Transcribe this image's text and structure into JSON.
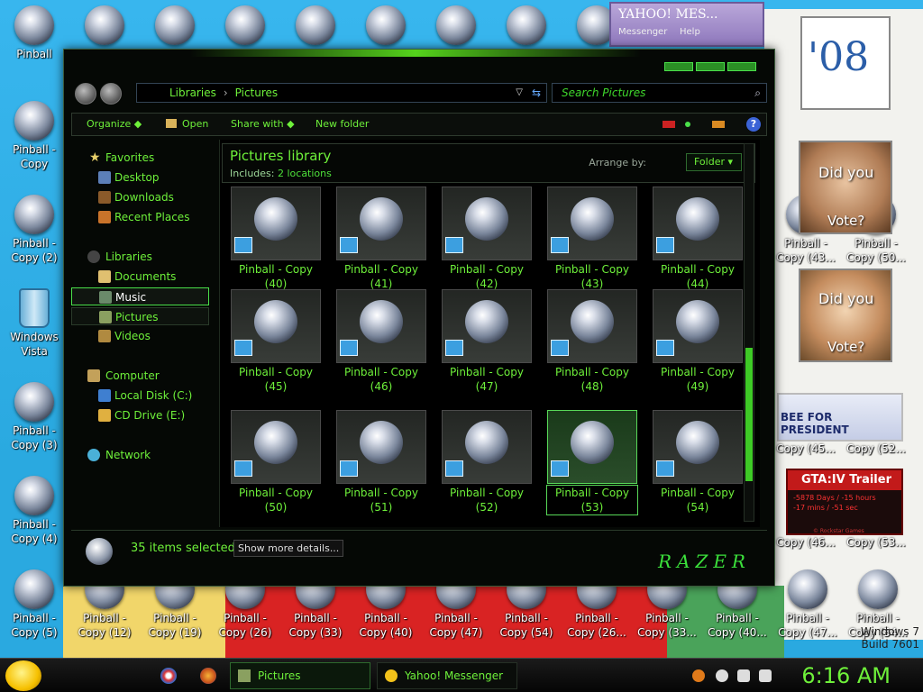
{
  "desktop": {
    "icons": [
      {
        "label": "Pinball"
      },
      {
        "label": "Pinball -\nCopy"
      },
      {
        "label": "Pinball -\nCopy (2)"
      },
      {
        "label": "Windows\nVista"
      },
      {
        "label": "Pinball -\nCopy (3)"
      },
      {
        "label": "Pinball -\nCopy (4)"
      },
      {
        "label": "Pinball -\nCopy (5)"
      }
    ],
    "bottom_row": [
      "Pinball -\nCopy (12)",
      "Pinball -\nCopy (19)",
      "Pinball -\nCopy (26)",
      "Pinball -\nCopy (33)",
      "Pinball -\nCopy (40)",
      "Pinball -\nCopy (47)",
      "Pinball -\nCopy (54)",
      "Pinball -\nCopy (26...",
      "Pinball -\nCopy (33...",
      "Pinball -\nCopy (40...",
      "Pinball -\nCopy (47...",
      "Pinball -\nCopy (54..."
    ],
    "right_labels": [
      "Pinball -\nCopy (43...",
      "Pinball -\nCopy (50...",
      "Copy (45...",
      "Copy (52...",
      "Copy (46...",
      "Copy (53..."
    ],
    "watermark": "Windows 7\nBuild 7601"
  },
  "gadgets": {
    "yahoo_title": "YAHOO! MES...",
    "yahoo_sub1": "Messenger",
    "yahoo_sub2": "Help",
    "year": "'08",
    "did_you_1": "Did you",
    "vote_1": "Vote?",
    "did_you_2": "Did you",
    "vote_2": "Vote?",
    "president": "BEE FOR PRESIDENT",
    "gta_title": "GTA:IV Trailer",
    "gta_line1": "-5878 Days / -15 hours",
    "gta_line2": "-17 mins / -51 sec",
    "gta_credit": "© Rockstar Games"
  },
  "explorer": {
    "address": {
      "part1": "Libraries",
      "part2": "Pictures"
    },
    "search_placeholder": "Search Pictures",
    "toolbar": {
      "organize": "Organize",
      "open": "Open",
      "share_with": "Share with",
      "new_folder": "New folder"
    },
    "nav": {
      "favorites": "Favorites",
      "desktop": "Desktop",
      "downloads": "Downloads",
      "recent": "Recent Places",
      "libraries": "Libraries",
      "documents": "Documents",
      "music": "Music",
      "pictures": "Pictures",
      "videos": "Videos",
      "computer": "Computer",
      "local_disk": "Local Disk (C:)",
      "cd_drive": "CD Drive (E:)",
      "network": "Network"
    },
    "library": {
      "title": "Pictures library",
      "includes_label": "Includes:",
      "locations": "2 locations",
      "arrange_by": "Arrange by:",
      "folder": "Folder"
    },
    "tiles": [
      {
        "name": "Pinball - Copy",
        "num": "(40)"
      },
      {
        "name": "Pinball - Copy",
        "num": "(41)"
      },
      {
        "name": "Pinball - Copy",
        "num": "(42)"
      },
      {
        "name": "Pinball - Copy",
        "num": "(43)"
      },
      {
        "name": "Pinball - Copy",
        "num": "(44)"
      },
      {
        "name": "Pinball - Copy",
        "num": "(45)"
      },
      {
        "name": "Pinball - Copy",
        "num": "(46)"
      },
      {
        "name": "Pinball - Copy",
        "num": "(47)"
      },
      {
        "name": "Pinball - Copy",
        "num": "(48)"
      },
      {
        "name": "Pinball - Copy",
        "num": "(49)"
      },
      {
        "name": "Pinball - Copy",
        "num": "(50)"
      },
      {
        "name": "Pinball - Copy",
        "num": "(51)"
      },
      {
        "name": "Pinball - Copy",
        "num": "(52)"
      },
      {
        "name": "Pinball - Copy",
        "num": "(53)"
      },
      {
        "name": "Pinball - Copy",
        "num": "(54)"
      }
    ],
    "details": {
      "count": "35 items selected",
      "more": "Show more details..."
    },
    "logo": "RAZER"
  },
  "taskbar": {
    "pictures": "Pictures",
    "messenger": "Yahoo! Messenger",
    "clock": "6:16 AM"
  },
  "colors": {
    "accent": "#6ef03a",
    "window_bg": "#050805",
    "desktop_bg": "#2aa9e0"
  }
}
